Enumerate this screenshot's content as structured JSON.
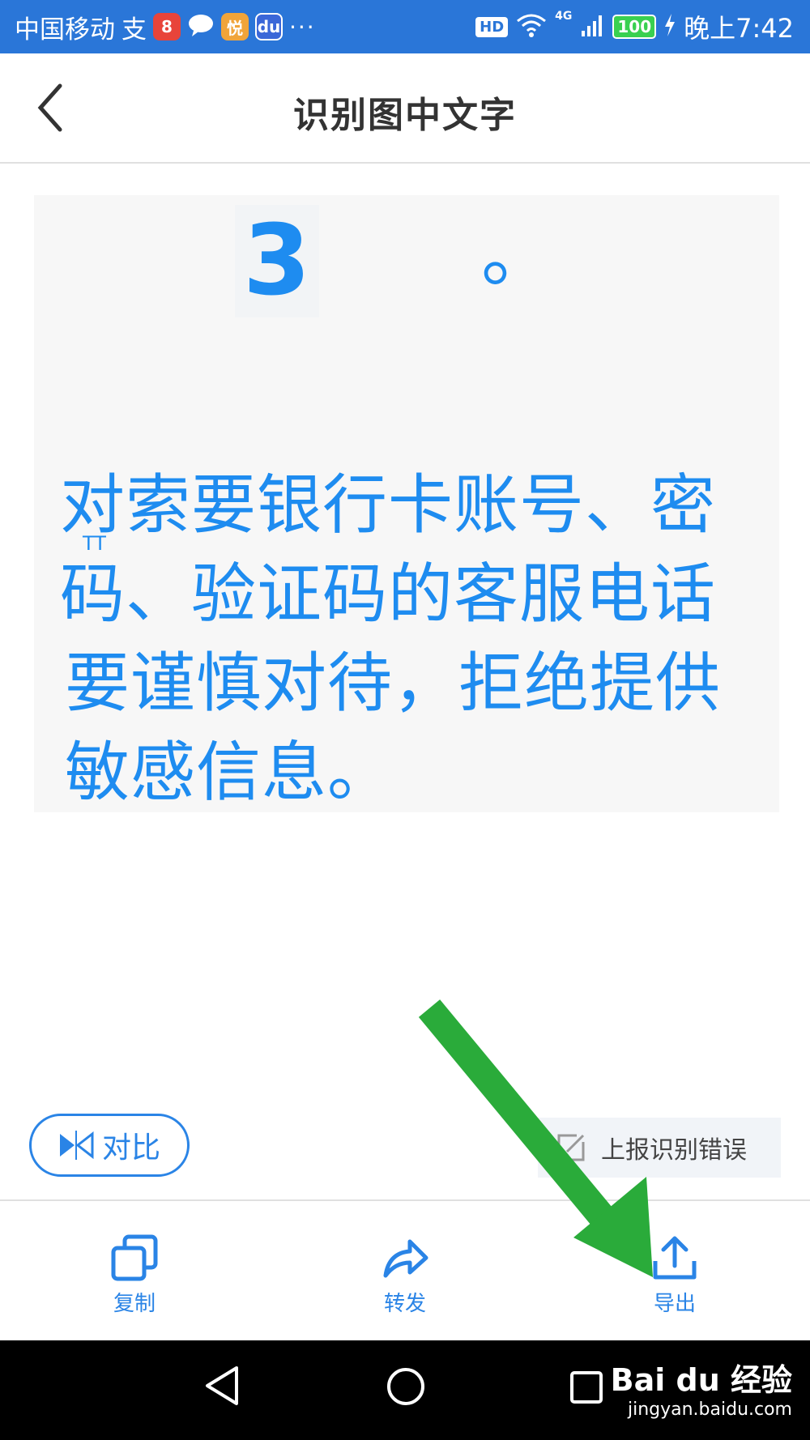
{
  "status_bar": {
    "carrier": "中国移动",
    "badge_alipay": "支",
    "badge_app1": "8",
    "badge_app2": "悦",
    "badge_baidu": "du",
    "more": "···",
    "hd": "HD",
    "network": "4G",
    "battery": "100",
    "time": "晚上7:42"
  },
  "header": {
    "title": "识别图中文字"
  },
  "preview": {
    "digit": "3",
    "dot": "。",
    "mark": "TT",
    "lines": [
      "对索要银行卡账号、密",
      "码、验证码的客服电话",
      "要谨慎对待，拒绝提供",
      "敏感信息。"
    ]
  },
  "actions": {
    "compare_label": "对比",
    "report_label": "上报识别错误"
  },
  "toolbar": {
    "copy_label": "复制",
    "forward_label": "转发",
    "export_label": "导出"
  },
  "watermark": {
    "logo": "Bai du 经验",
    "url": "jingyan.baidu.com"
  },
  "colors": {
    "status_bar": "#2a76d8",
    "accent": "#2a84e6",
    "ocr_text": "#1e8cf0",
    "annotation": "#2aab3a"
  }
}
